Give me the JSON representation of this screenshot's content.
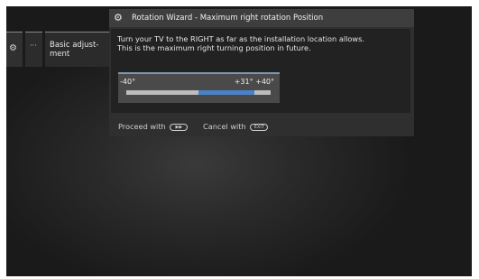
{
  "menu": {
    "gear_icon": "gear-icon",
    "more_label": "···",
    "basic_label": "Basic adjust- ment"
  },
  "dialog": {
    "title": "Rotation Wizard - Maximum right rotation Position",
    "title_icon": "gears-icon",
    "message_line1": "Turn your TV to the RIGHT as far as the installation location allows.",
    "message_line2": "This is the maximum right turning position in future.",
    "slider": {
      "min_label": "-40°",
      "max_label": "+31° +40°",
      "min": -40,
      "max": 40,
      "current": 31,
      "fill_start_fraction": 0.5,
      "fill_end_fraction": 0.89
    },
    "footer": {
      "proceed_label": "Proceed with",
      "proceed_key": "▶▶",
      "cancel_label": "Cancel with",
      "cancel_key": "EXIT"
    }
  },
  "colors": {
    "accent": "#4a82c8",
    "title_bar": "#3e3e3e",
    "body": "#222222"
  }
}
